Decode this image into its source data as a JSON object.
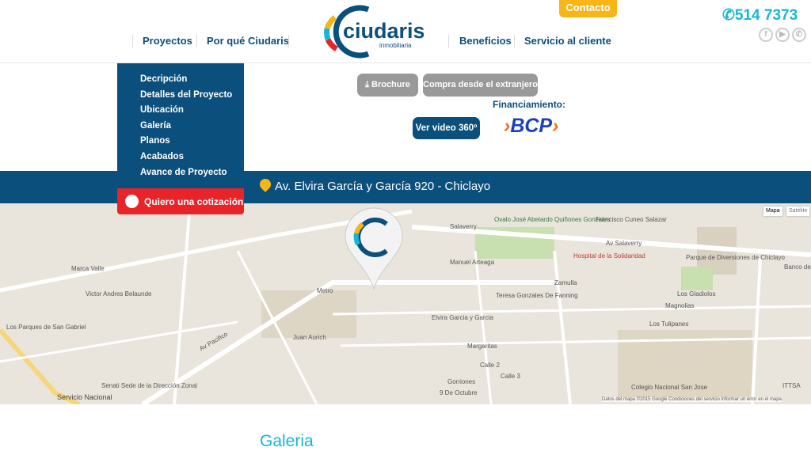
{
  "header": {
    "nav_left": [
      "Proyectos",
      "Por qué Ciudaris"
    ],
    "nav_right": [
      "Beneficios",
      "Servicio al cliente"
    ],
    "logo_text": "ciudaris",
    "logo_sub": "inmobiliaria",
    "contact": "Contacto",
    "phone": "514 7373",
    "social": [
      "facebook-icon",
      "youtube-icon",
      "whatsapp-icon"
    ]
  },
  "menu": {
    "items": [
      "Decripción",
      "Detalles del Proyecto",
      "Ubicación",
      "Galería",
      "Planos",
      "Acabados",
      "Avance de Proyecto"
    ],
    "quote": "Quiero una cotización"
  },
  "actions": {
    "brochure": "Brochure",
    "abroad": "Compra desde el extranjero",
    "financing": "Financiamiento:",
    "video": "Ver video 360º",
    "bank": "BCP"
  },
  "address": "Av. Elvira García y García 920 - Chiclayo",
  "map": {
    "types": [
      "Mapa",
      "Satélite"
    ],
    "labels": [
      "Salaverry",
      "Francisco Cuneo Salazar",
      "Av Salaverry",
      "Hospital de la Solidaridad",
      "Parque de Diversiones de Chiclayo",
      "Ovalo José Abelardo Quiñones Gonzales",
      "Manuel Arteaga",
      "Zamulla",
      "Teresa Gonzales De Fanning",
      "Los Gladiolos",
      "Magnolias",
      "Los Tulipanes",
      "Elvira Garcia y Garcia",
      "Margaritas",
      "Calle 2",
      "Calle 3",
      "Gorriones",
      "9 De Octubre",
      "Colegio Nacional San Jose",
      "Av Pacifico",
      "Los Parques de San Gabriel",
      "Juan Aurich",
      "Victor Andres Belaunde",
      "Marca Valle",
      "Metro",
      "Senati Sede de la Dirección Zonal",
      "Servicio Nacional",
      "ITTSA",
      "Banco de"
    ],
    "footer": "Datos del mapa ©2015 Google    Condiciones del servicio    Informar un error en el mapa"
  },
  "gallery_title": "Galeria"
}
